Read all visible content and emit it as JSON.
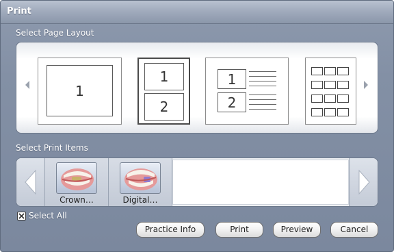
{
  "dialog": {
    "title": "Print"
  },
  "layout_section": {
    "label": "Select Page Layout",
    "options": [
      {
        "page_labels": [
          "1"
        ]
      },
      {
        "page_labels": [
          "1",
          "2"
        ],
        "selected": true
      },
      {
        "page_labels": [
          "1",
          "2"
        ]
      },
      {
        "page_labels": []
      }
    ]
  },
  "items_section": {
    "label": "Select Print Items",
    "items": [
      {
        "caption": "Crown…",
        "icon": "teeth-crown-image"
      },
      {
        "caption": "Digital…",
        "icon": "teeth-digital-image"
      }
    ]
  },
  "select_all": {
    "label": "Select All",
    "checked": true
  },
  "buttons": {
    "practice_info": "Practice Info",
    "print": "Print",
    "preview": "Preview",
    "cancel": "Cancel"
  }
}
